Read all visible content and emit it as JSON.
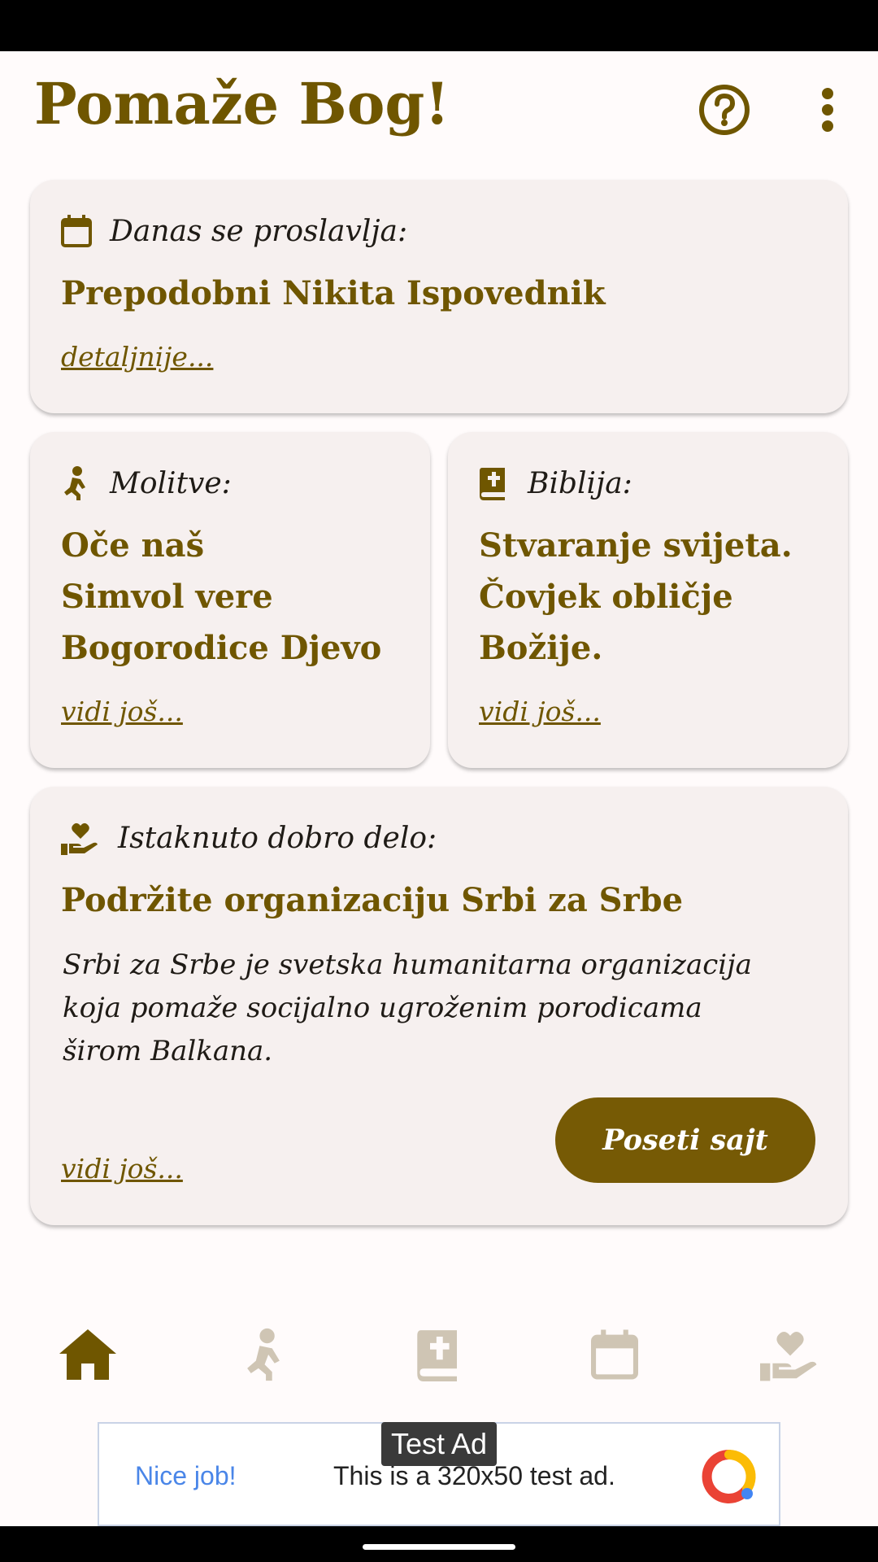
{
  "app": {
    "title": "Pomaže Bog!"
  },
  "colors": {
    "primary": "#6f5600",
    "button": "#765a05",
    "card": "#f6f0ef",
    "nav_inactive": "#cfc5b4"
  },
  "icons": {
    "help": "help-circle-icon",
    "menu": "more-vertical-icon"
  },
  "today_card": {
    "header": "Danas se proslavlja:",
    "icon": "calendar-icon",
    "title": "Prepodobni Nikita Ispovednik",
    "link": "detaljnije..."
  },
  "prayers_card": {
    "header": "Molitve:",
    "icon": "praying-icon",
    "items": [
      "Oče naš",
      "Simvol vere",
      "Bogorodice Djevo"
    ],
    "link": "vidi još..."
  },
  "bible_card": {
    "header": "Biblija:",
    "icon": "bible-icon",
    "lines": [
      "Stvaranje svijeta.",
      "Čovjek obličje",
      "Božije."
    ],
    "link": "vidi još..."
  },
  "charity_card": {
    "header": "Istaknuto dobro delo:",
    "icon": "hand-heart-icon",
    "title": "Podržite organizaciju Srbi za Srbe",
    "description_lines": [
      "Srbi za Srbe je svetska humanitarna organizacija",
      "koja pomaže socijalno ugroženim porodicama",
      "širom Balkana."
    ],
    "button": "Poseti sajt",
    "link": "vidi još..."
  },
  "bottom_nav": [
    {
      "icon": "home-icon",
      "active": true
    },
    {
      "icon": "praying-icon",
      "active": false
    },
    {
      "icon": "bible-icon",
      "active": false
    },
    {
      "icon": "calendar-icon",
      "active": false
    },
    {
      "icon": "hand-heart-icon",
      "active": false
    }
  ],
  "ad": {
    "tag": "Test Ad",
    "nice": "Nice job!",
    "text": "This is a 320x50 test ad."
  }
}
